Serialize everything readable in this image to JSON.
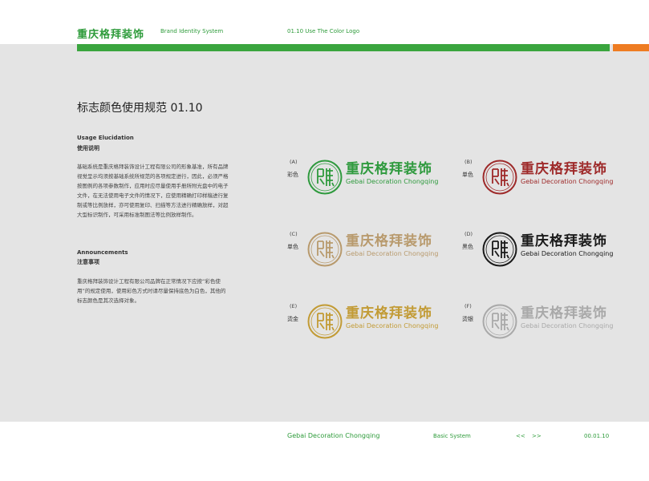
{
  "header": {
    "brand": "重庆格拜装饰",
    "system": "Brand Identity System",
    "section": "01.10  Use The Color Logo"
  },
  "page_title": "标志颜色使用规范  01.10",
  "usage": {
    "heading_en": "Usage Elucidation",
    "heading_cn": "使用说明",
    "body": "基础系统是重庆格拜装饰设计工程有限公司的形象基准，所有品牌视觉呈示均须按基础系统所规范的各项规定进行，因此，必须严格按图例的各项参数制作，应用时应尽量使用手册所附光盘中的电子文件，在无法使用电子文件的情况下，应使用精确打印样稿进行复制或等比例放样，亦可使用复印、扫描等方法进行精确放样，对超大型标识制作，可采用标准制图法等比例放样制作。"
  },
  "announcements": {
    "heading_en": "Announcements",
    "heading_cn": "注意事项",
    "body": "重庆格拜装饰设计工程有限公司品牌在正常情况下应按“彩色使用”的规定使用，使用彩色方式时请尽量保持底色为白色，其他的标志颜色是其次选择对象。"
  },
  "logo_variants": [
    {
      "letter": "(A)",
      "label": "彩色",
      "name_cn": "重庆格拜装饰",
      "name_en": "Gebai Decoration Chongqing",
      "color": "#2f9a3e"
    },
    {
      "letter": "(B)",
      "label": "单色",
      "name_cn": "重庆格拜装饰",
      "name_en": "Gebai Decoration Chongqing",
      "color": "#9e2a2a"
    },
    {
      "letter": "(C)",
      "label": "单色",
      "name_cn": "重庆格拜装饰",
      "name_en": "Gebai Decoration Chongqing",
      "color": "#b89a6d"
    },
    {
      "letter": "(D)",
      "label": "黑色",
      "name_cn": "重庆格拜装饰",
      "name_en": "Gebai Decoration Chongqing",
      "color": "#1a1a1a"
    },
    {
      "letter": "(E)",
      "label": "烫金",
      "name_cn": "重庆格拜装饰",
      "name_en": "Gebai Decoration Chongqing",
      "color": "#c29b35"
    },
    {
      "letter": "(F)",
      "label": "烫银",
      "name_cn": "重庆格拜装饰",
      "name_en": "Gebai Decoration Chongqing",
      "color": "#a9a9a9"
    }
  ],
  "footer": {
    "company_en": "Gebai Decoration Chongqing",
    "section": "Basic System",
    "prev": "<<",
    "next": ">>",
    "page": "00.01.10"
  },
  "colors": {
    "brand_green": "#3aa53e",
    "accent_orange": "#ee7c22",
    "page_gray": "#e4e4e4"
  }
}
